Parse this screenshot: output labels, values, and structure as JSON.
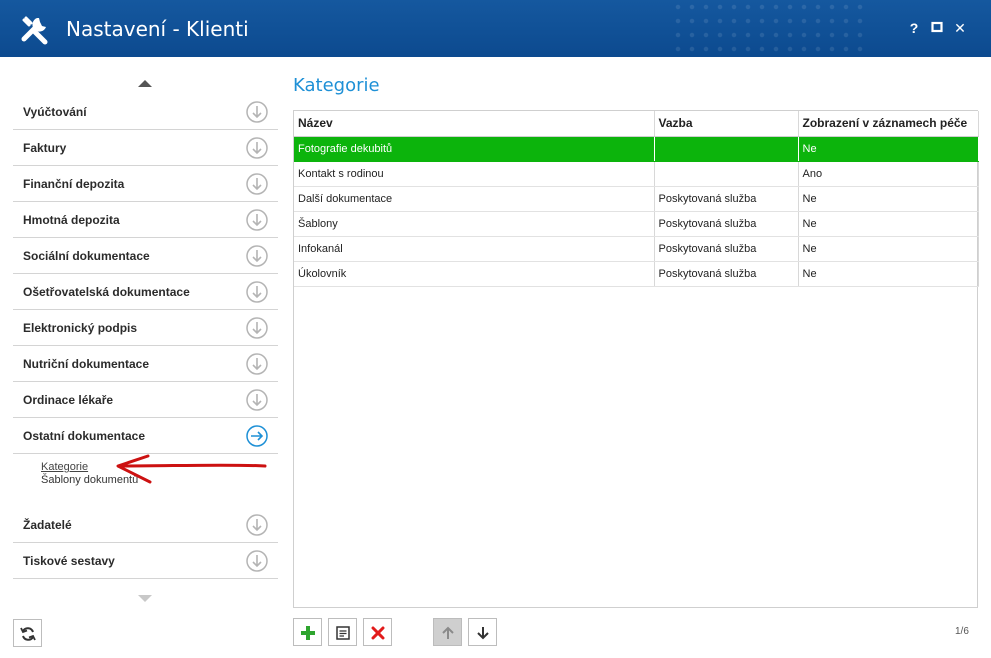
{
  "window": {
    "title": "Nastavení - Klienti",
    "help_label": "?",
    "close_label": "✕"
  },
  "sidebar": {
    "items": [
      {
        "label": "Vyúčtování",
        "state": "collapsed"
      },
      {
        "label": "Faktury",
        "state": "collapsed"
      },
      {
        "label": "Finanční depozita",
        "state": "collapsed"
      },
      {
        "label": "Hmotná depozita",
        "state": "collapsed"
      },
      {
        "label": "Sociální dokumentace",
        "state": "collapsed"
      },
      {
        "label": "Ošetřovatelská dokumentace",
        "state": "collapsed"
      },
      {
        "label": "Elektronický podpis",
        "state": "collapsed"
      },
      {
        "label": "Nutriční dokumentace",
        "state": "collapsed"
      },
      {
        "label": "Ordinace lékaře",
        "state": "collapsed"
      },
      {
        "label": "Ostatní dokumentace",
        "state": "expanded"
      },
      {
        "label": "Žadatelé",
        "state": "collapsed"
      },
      {
        "label": "Tiskové sestavy",
        "state": "collapsed"
      }
    ],
    "sub_items": [
      {
        "label": "Kategorie",
        "active": true
      },
      {
        "label": "Šablony dokumentů",
        "active": false
      }
    ]
  },
  "main": {
    "title": "Kategorie",
    "columns": [
      "Název",
      "Vazba",
      "Zobrazení v záznamech péče"
    ],
    "rows": [
      [
        "Fotografie dekubitů",
        "",
        "Ne"
      ],
      [
        "Kontakt s rodinou",
        "",
        "Ano"
      ],
      [
        "Další dokumentace",
        "Poskytovaná služba",
        "Ne"
      ],
      [
        "Šablony",
        "Poskytovaná služba",
        "Ne"
      ],
      [
        "Infokanál",
        "Poskytovaná služba",
        "Ne"
      ],
      [
        "Úkolovník",
        "Poskytovaná služba",
        "Ne"
      ]
    ],
    "selected_row": 0,
    "pager": "1/6"
  },
  "colors": {
    "titlebar": "#0f4f96",
    "accent": "#1e90d6",
    "selection": "#0cb40c",
    "annotation_arrow": "#cc1111"
  }
}
